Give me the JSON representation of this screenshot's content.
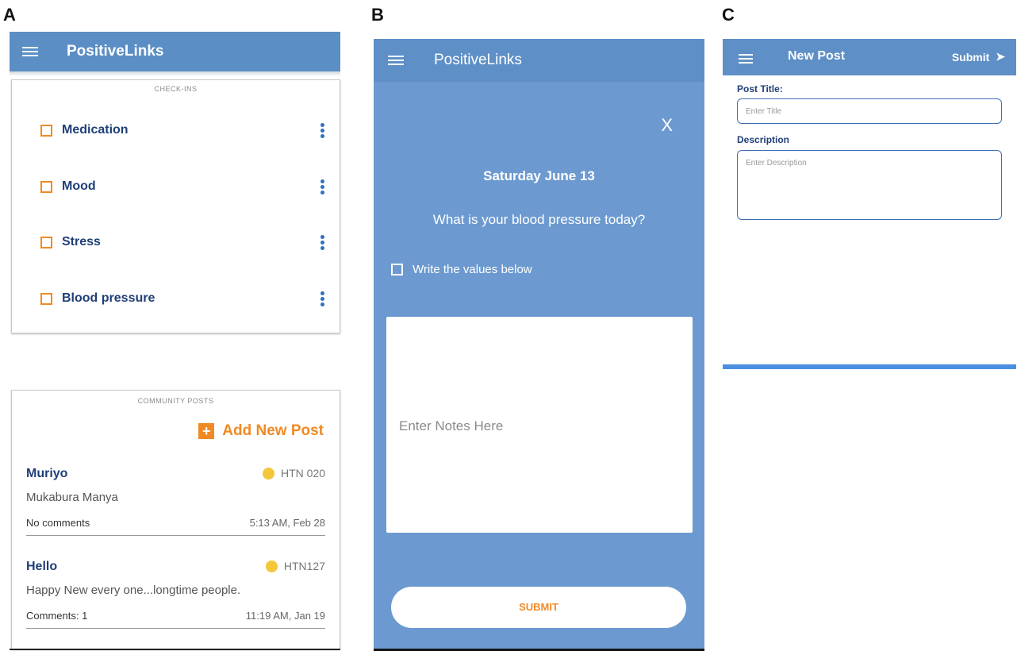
{
  "panel_letters": {
    "a": "A",
    "b": "B",
    "c": "C"
  },
  "panel_a": {
    "app_title": "PositiveLinks",
    "checkins": {
      "header": "CHECK-INS",
      "items": [
        {
          "label": "Medication"
        },
        {
          "label": "Mood"
        },
        {
          "label": "Stress"
        },
        {
          "label": "Blood pressure"
        }
      ]
    },
    "community": {
      "header": "COMMUNITY POSTS",
      "add_label": "Add New Post",
      "posts": [
        {
          "author": "Muriyo",
          "tag": "HTN 020",
          "body": "Mukabura Manya",
          "comments": "No comments",
          "time": "5:13 AM, Feb 28"
        },
        {
          "author": "Hello",
          "tag": "HTN127",
          "body": "Happy New every one...longtime people.",
          "comments": "Comments: 1",
          "time": "11:19 AM, Jan 19"
        }
      ]
    }
  },
  "panel_b": {
    "app_title": "PositiveLinks",
    "close_label": "X",
    "date": "Saturday June 13",
    "question": "What is your blood pressure today?",
    "checkbox_label": "Write the values below",
    "notes_placeholder": "Enter Notes Here",
    "submit_label": "SUBMIT"
  },
  "panel_c": {
    "title": "New Post",
    "submit_label": "Submit",
    "post_title_label": "Post Title:",
    "post_title_placeholder": "Enter Title",
    "description_label": "Description",
    "description_placeholder": "Enter Description"
  },
  "colors": {
    "appbar": "#5b8ec4",
    "panel_b_bg": "#6c9ad0",
    "accent_orange": "#f08a24",
    "label_navy": "#1f3f77",
    "bottom_bar_blue": "#4a90e2"
  }
}
